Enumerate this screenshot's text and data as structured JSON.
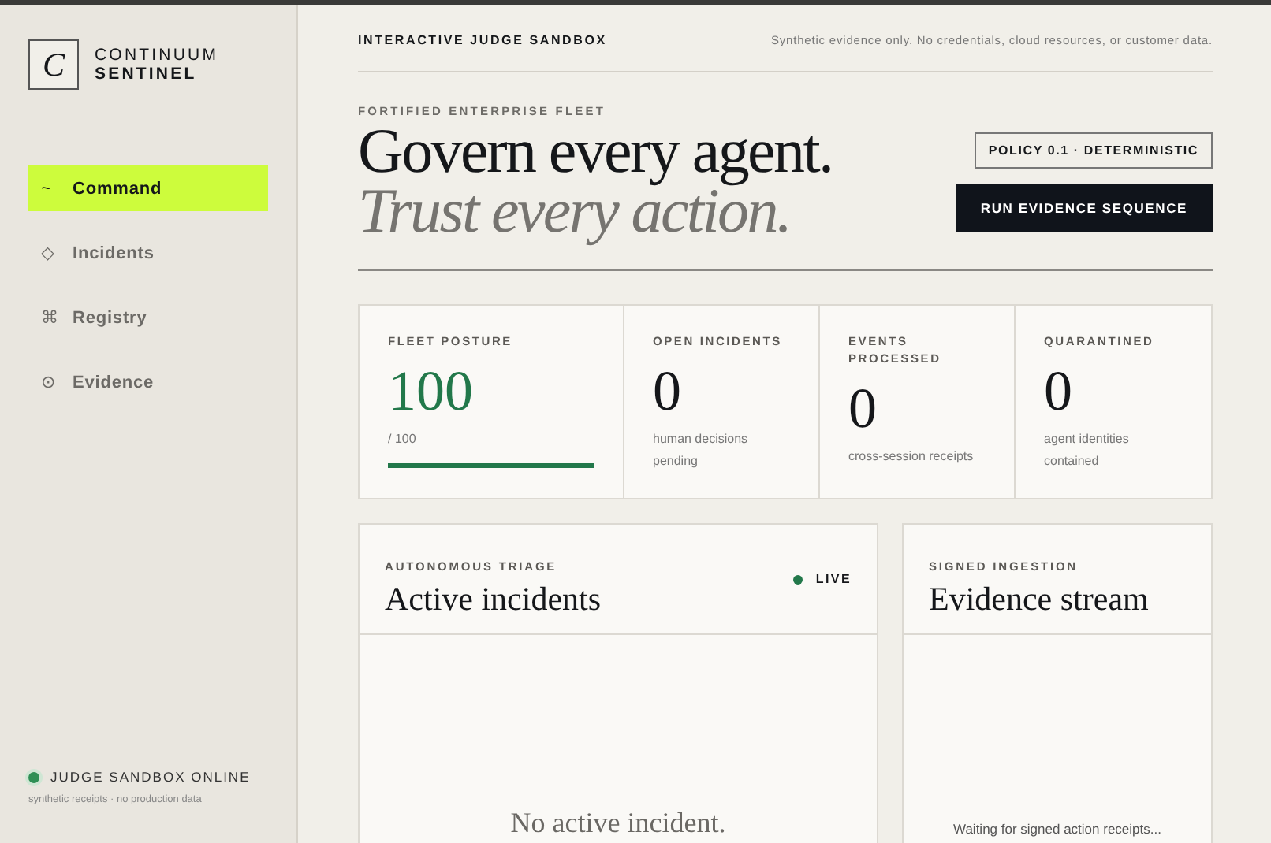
{
  "brand": {
    "mark": "C",
    "line1": "CONTINUUM",
    "line2": "SENTINEL"
  },
  "sidebar": {
    "items": [
      {
        "icon": "~",
        "label": "Command",
        "selected": true
      },
      {
        "icon": "◇",
        "label": "Incidents",
        "selected": false
      },
      {
        "icon": "⌘",
        "label": "Registry",
        "selected": false
      },
      {
        "icon": "⊙",
        "label": "Evidence",
        "selected": false
      }
    ],
    "status": {
      "label": "JUDGE SANDBOX ONLINE",
      "online": true,
      "note": "synthetic receipts · no production data"
    }
  },
  "topbar": {
    "title": "INTERACTIVE JUDGE SANDBOX",
    "note": "Synthetic evidence only. No credentials, cloud resources, or customer data."
  },
  "hero": {
    "eyebrow": "FORTIFIED ENTERPRISE FLEET",
    "headline": "Govern every agent.",
    "subline": "Trust every action.",
    "policy": "POLICY 0.1 · DETERMINISTIC",
    "button": "RUN EVIDENCE SEQUENCE"
  },
  "stats": [
    {
      "kind": "gauge",
      "label": "FLEET POSTURE",
      "value": "100",
      "sub": "/ 100",
      "level": 1
    },
    {
      "kind": "count",
      "label": "OPEN INCIDENTS",
      "value": "0",
      "sub": "human decisions pending"
    },
    {
      "kind": "count",
      "label": "EVENTS PROCESSED",
      "value": "0",
      "sub": "cross-session receipts"
    },
    {
      "kind": "count",
      "label": "QUARANTINED",
      "value": "0",
      "sub": "agent identities contained"
    }
  ],
  "panels": [
    {
      "eyebrow": "AUTONOMOUS TRIAGE",
      "title": "Active incidents",
      "live": true,
      "live_label": "LIVE",
      "empty": "No active incident.",
      "kind": "incidents"
    },
    {
      "eyebrow": "SIGNED INGESTION",
      "title": "Evidence stream",
      "live": false,
      "empty": "Waiting for signed action receipts...",
      "kind": "stream"
    }
  ]
}
